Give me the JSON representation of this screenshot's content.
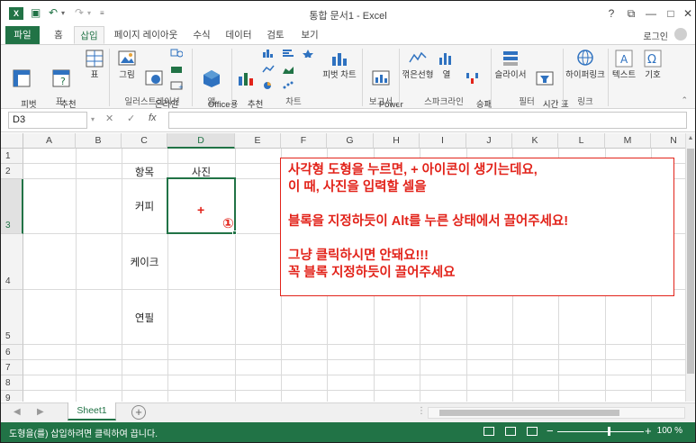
{
  "window": {
    "title": "통합 문서1 - Excel",
    "help_icon": "help-icon",
    "buttons": [
      "?",
      "⧉",
      "—",
      "□",
      "✕"
    ]
  },
  "tabs": [
    {
      "label": "파일"
    },
    {
      "label": "홈"
    },
    {
      "label": "삽입"
    },
    {
      "label": "페이지 레이아웃"
    },
    {
      "label": "수식"
    },
    {
      "label": "데이터"
    },
    {
      "label": "검토"
    },
    {
      "label": "보기"
    }
  ],
  "active_tab": "삽입",
  "login": "로그인",
  "ribbon": {
    "pivot_table": "피벗\n테이블",
    "recommended_pivot": "추천\n피벗 테이블",
    "table": "표",
    "group_tables": "표",
    "picture": "그림",
    "online_picture": "온라인\n그림",
    "group_illustrations": "일러스트레이션",
    "office_apps": "Office용\n앱",
    "group_apps": "앱",
    "recommended_charts": "추천\n차트",
    "pivot_chart": "피벗 차트",
    "group_charts": "차트",
    "power_view": "Power\nView",
    "group_reports": "보고서",
    "spark_line": "꺾은선형",
    "spark_column": "열",
    "spark_winloss": "승패\n(W)",
    "group_sparklines": "스파크라인",
    "slicer": "슬라이서",
    "timeline": "시간 표\n시 막대",
    "group_filters": "필터",
    "hyperlink": "하이퍼링크",
    "group_links": "링크",
    "text": "텍스트",
    "symbols": "기호"
  },
  "formula_bar": {
    "name_box": "D3",
    "cancel": "✕",
    "enter": "✓",
    "fx": "fx",
    "value": ""
  },
  "columns": [
    "A",
    "B",
    "C",
    "D",
    "E",
    "F",
    "G",
    "H",
    "I",
    "J",
    "K",
    "L",
    "M",
    "N"
  ],
  "rows": [
    "1",
    "2",
    "3",
    "4",
    "5",
    "6",
    "7",
    "8",
    "9"
  ],
  "cells": {
    "C2": "항목",
    "D2": "사진",
    "C3": "커피",
    "C4": "케이크",
    "C5": "연필"
  },
  "annotation": {
    "plus": "+",
    "marker": "①",
    "lines": [
      "사각형 도형을 누르면, + 아이콘이 생기는데요,",
      "이 때, 사진을 입력할 셀을",
      "",
      "블록을 지정하듯이 Alt를 누른 상태에서 끌어주세요!",
      "",
      "그냥 클릭하시면 안돼요!!!",
      "꼭 블록 지정하듯이 끌어주세요"
    ]
  },
  "sheet_tabs": [
    "Sheet1"
  ],
  "status": {
    "message": "도형을(를) 삽입하려면 클릭하여 끕니다.",
    "zoom": "100 %",
    "zoom_minus": "−",
    "zoom_plus": "+"
  },
  "colors": {
    "excel_green": "#217346",
    "annotation_red": "#e2231a"
  }
}
